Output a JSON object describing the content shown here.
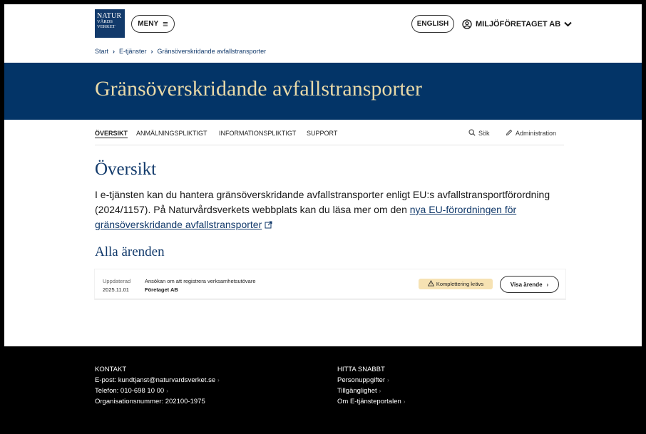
{
  "logo": {
    "line1": "NATUR",
    "line2": "VÅRDS",
    "line3": "VERKET"
  },
  "header": {
    "menu_label": "MENY",
    "english_label": "ENGLISH",
    "account_label": "MILJÖFÖRETAGET AB"
  },
  "breadcrumb": [
    "Start",
    "E-tjänster",
    "Gränsöverskridande avfallstransporter"
  ],
  "hero": {
    "title": "Gränsöverskridande avfallstransporter"
  },
  "subnav": {
    "tabs": [
      "ÖVERSIKT",
      "ANMÄLNINGSPLIKTIGT",
      "INFORMATIONSPLIKTIGT",
      "SUPPORT"
    ],
    "search_label": "Sök",
    "admin_label": "Administration"
  },
  "overview": {
    "heading": "Översikt",
    "intro_text": "I e-tjänsten kan du hantera gränsöverskridande avfallstransporter enligt EU:s avfallstransportförordning (2024/1157). På Naturvårdsverkets webbplats kan du läsa mer om den ",
    "intro_link": "nya EU-förordningen för gränsöverskridande avfallstransporter"
  },
  "cases": {
    "heading": "Alla ärenden",
    "items": [
      {
        "updated_label": "Uppdaterad",
        "updated_date": "2025.11.01",
        "title": "Ansökan om att registrera verksamhetsutövare",
        "company": "Företaget AB",
        "status": "Komplettering krävs",
        "action": "Visa ärende"
      }
    ]
  },
  "footer": {
    "contact": {
      "heading": "KONTAKT",
      "email": "E-post: kundtjanst@naturvardsverket.se",
      "phone": "Telefon: 010-698 10 00",
      "org": "Organisationsnummer: 202100-1975"
    },
    "quick": {
      "heading": "HITTA SNABBT",
      "links": [
        "Personuppgifter",
        "Tillgänglighet",
        "Om E-tjänsteportalen"
      ]
    }
  },
  "colors": {
    "brand": "#033467",
    "accent": "#e8d9a8",
    "warning": "#f6e2b3"
  }
}
